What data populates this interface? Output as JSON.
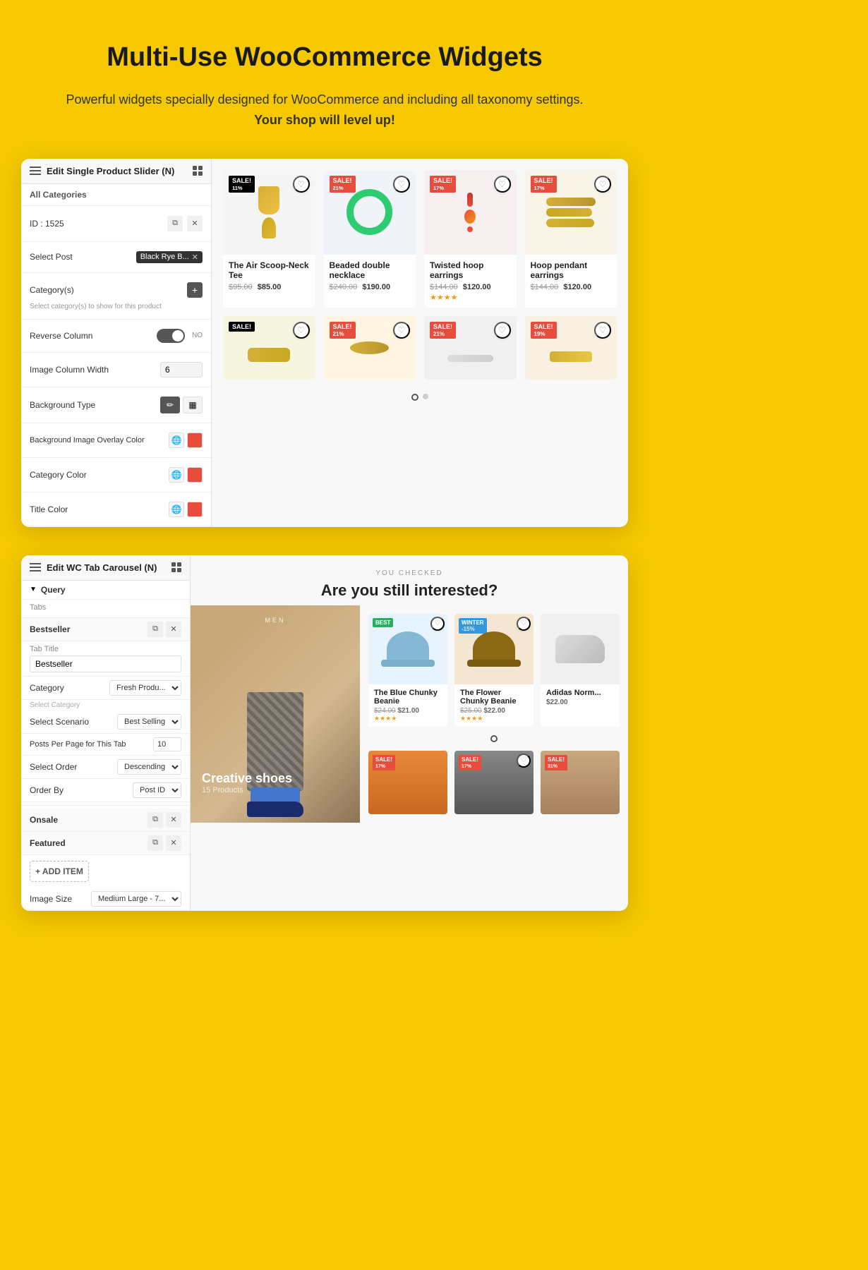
{
  "page": {
    "title": "Multi-Use WooCommerce Widgets",
    "subtitle_normal": "Powerful widgets specially designed for WooCommerce and including all taxonomy settings.",
    "subtitle_bold": "Your shop will level up!"
  },
  "widget1": {
    "panel_title": "Edit Single Product Slider (N)",
    "all_categories": "All Categories",
    "id_label": "ID : 1525",
    "select_post_label": "Select Post",
    "select_post_value": "Black Rye B...",
    "categories_label": "Category(s)",
    "helper_text": "Select category(s) to show for this product",
    "reverse_column_label": "Reverse Column",
    "toggle_state": "NO",
    "image_column_label": "Image Column Width",
    "image_column_value": "6",
    "bg_type_label": "Background Type",
    "bg_overlay_label": "Background Image Overlay Color",
    "category_color_label": "Category Color",
    "title_color_label": "Title Color",
    "products": [
      {
        "badge": "SALE! 11%",
        "name": "The Air Scoop-Neck Tee",
        "old_price": "$95.00",
        "new_price": "$85.00",
        "stars": ""
      },
      {
        "badge": "SALE! 21%",
        "name": "Beaded double necklace",
        "old_price": "$240.00",
        "new_price": "$190.00",
        "stars": ""
      },
      {
        "badge": "SALE! 17%",
        "name": "Twisted hoop earrings",
        "old_price": "$144.00",
        "new_price": "$120.00",
        "stars": "★★★★"
      },
      {
        "badge": "SALE! 17%",
        "name": "Hoop pendant earrings",
        "old_price": "$144.00",
        "new_price": "$120.00",
        "stars": ""
      }
    ]
  },
  "widget2": {
    "panel_title": "Edit WC Tab Carousel (N)",
    "query_label": "Query",
    "tabs_label": "Tabs",
    "tab1_name": "Bestseller",
    "tab1_title_label": "Tab Title",
    "tab1_title_value": "Bestseller",
    "category_label": "Category",
    "category_value": "Fresh Produ...",
    "select_category_placeholder": "Select Category",
    "select_scenario_label": "Select Scenario",
    "select_scenario_value": "Best Selling",
    "posts_per_page_label": "Posts Per Page for This Tab",
    "posts_per_page_value": "10",
    "select_order_label": "Select Order",
    "select_order_value": "Descending",
    "order_by_label": "Order By",
    "order_by_value": "Post ID",
    "tab2_name": "Onsale",
    "tab3_name": "Featured",
    "add_item_label": "+ ADD ITEM",
    "image_size_label": "Image Size",
    "image_size_value": "Medium Large - 7...",
    "you_checked_label": "YOU CHECKED",
    "section_title": "Are you still interested?",
    "featured_category": "MEN",
    "featured_title": "Creative shoes",
    "featured_count": "15 Products",
    "products": [
      {
        "badge": "BEST",
        "badge_type": "best",
        "name": "The Blue Chunky Beanie",
        "old_price": "$24.00",
        "new_price": "$21.00",
        "stars": "★★★★"
      },
      {
        "badge": "WINTER -15%",
        "badge_type": "winter",
        "name": "The Flower Chunky Beanie",
        "old_price": "$25.00",
        "new_price": "$22.00",
        "stars": "★★★★"
      },
      {
        "badge": "",
        "badge_type": "none",
        "name": "Adidas Norm...",
        "old_price": "",
        "new_price": "$22.00",
        "stars": ""
      }
    ],
    "bottom_products": [
      {
        "badge": "SALE! 17%",
        "name": "",
        "color": "orange"
      },
      {
        "badge": "SALE! 17%",
        "name": "",
        "color": "gray"
      },
      {
        "badge": "SALE! 31%",
        "name": "",
        "color": "tan"
      }
    ]
  }
}
